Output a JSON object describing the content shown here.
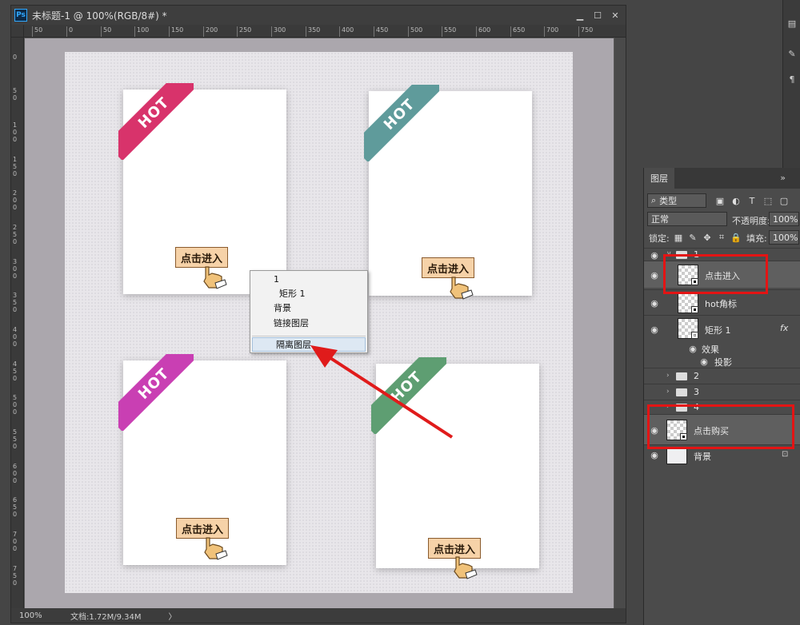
{
  "document": {
    "title": "未标题-1 @ 100%(RGB/8#) *",
    "app_icon": "Ps",
    "zoom": "100%",
    "doc_size": "文档:1.72M/9.34M",
    "status_arrow": "〉"
  },
  "ruler": {
    "h_ticks": [
      "50",
      "0",
      "50",
      "100",
      "150",
      "200",
      "250",
      "300",
      "350",
      "400",
      "450",
      "500",
      "550",
      "600",
      "650",
      "700",
      "750"
    ],
    "v_ticks": [
      "0",
      "5 0",
      "1 0 0",
      "1 5 0",
      "2 0 0",
      "2 5 0",
      "3 0 0",
      "3 5 0",
      "4 0 0",
      "4 5 0",
      "5 0 0",
      "5 5 0",
      "6 0 0",
      "6 5 0",
      "7 0 0",
      "7 5 0"
    ]
  },
  "cards": [
    {
      "badge": "HOT",
      "cta": "点击进入",
      "color": "#d8336b",
      "color_dark": "#9c1f49"
    },
    {
      "badge": "HOT",
      "cta": "点击进入",
      "color": "#5f9b9b",
      "color_dark": "#3f6e6e"
    },
    {
      "badge": "HOT",
      "cta": "点击进入",
      "color": "#c93fb3",
      "color_dark": "#8f2a80"
    },
    {
      "badge": "HOT",
      "cta": "点击进入",
      "color": "#5e9e72",
      "color_dark": "#3f7050"
    }
  ],
  "context_menu": {
    "items": [
      "1",
      "矩形 1",
      "背景",
      "链接图层",
      "隔离图层"
    ],
    "highlighted": "隔离图层"
  },
  "layers_panel": {
    "tab": "图层",
    "filter_kind": "类型",
    "blend_mode": "正常",
    "opacity_label": "不透明度:",
    "opacity_value": "100%",
    "lock_label": "锁定:",
    "fill_label": "填充:",
    "fill_value": "100%",
    "layers": [
      {
        "name": "1",
        "type": "group"
      },
      {
        "name": "点击进入",
        "type": "smart"
      },
      {
        "name": "hot角标",
        "type": "smart"
      },
      {
        "name": "矩形 1",
        "type": "shape",
        "fx": "fx"
      },
      {
        "name": "效果",
        "type": "effect"
      },
      {
        "name": "投影",
        "type": "effect"
      },
      {
        "name": "2",
        "type": "group"
      },
      {
        "name": "3",
        "type": "group"
      },
      {
        "name": "4",
        "type": "group"
      },
      {
        "name": "点击购买",
        "type": "smart"
      },
      {
        "name": "背景",
        "type": "background"
      }
    ]
  },
  "colors": {
    "highlight_red": "#e31414",
    "arrow_red": "#e01b1b",
    "cta_fill": "#f6d2a8"
  }
}
